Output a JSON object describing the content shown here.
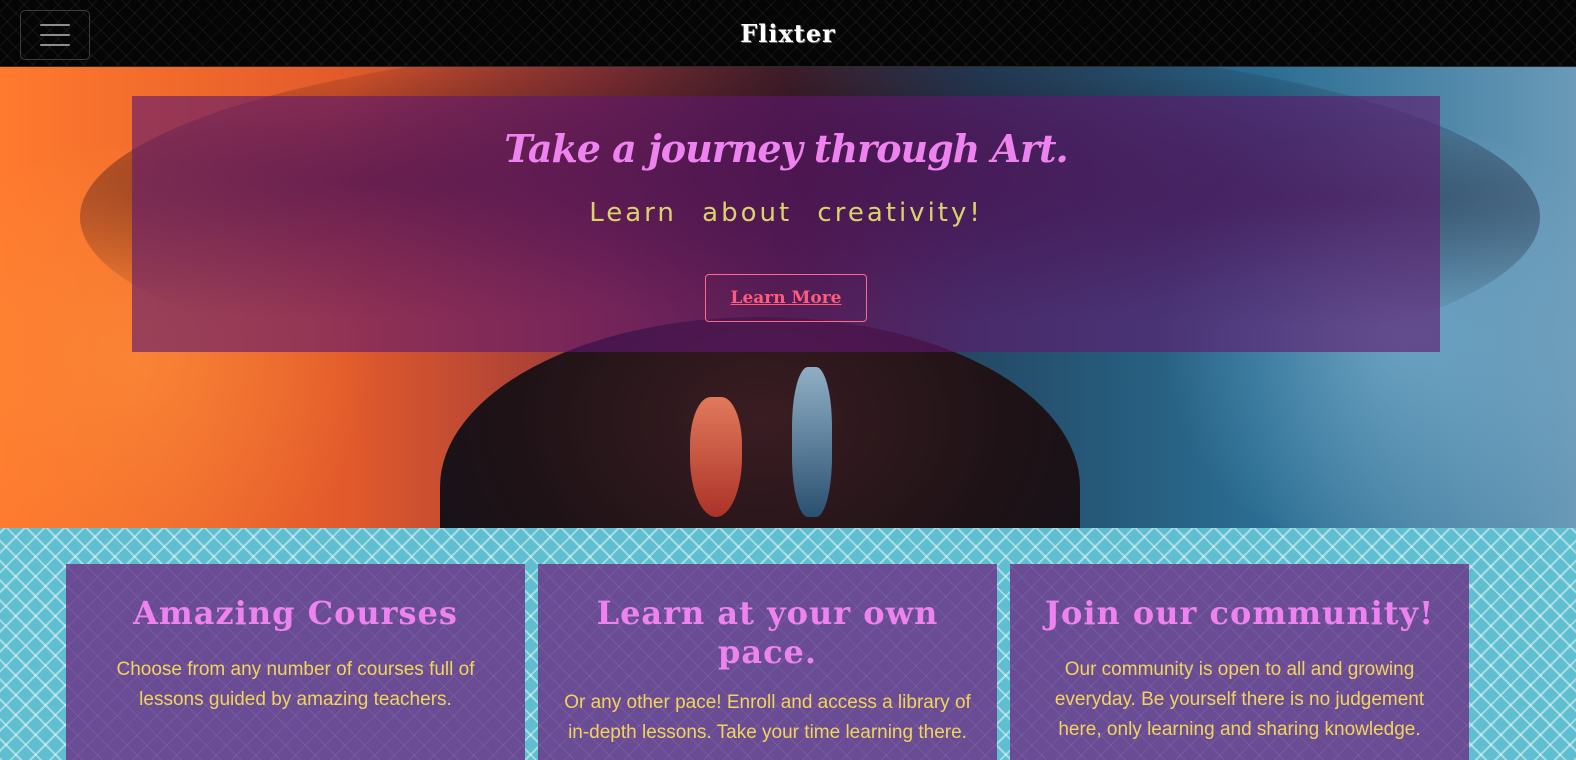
{
  "navbar": {
    "toggler_icon": "menu-icon",
    "brand": "Flixter"
  },
  "hero": {
    "title": "Take a journey through Art.",
    "subtitle": "Learn about creativity!",
    "button_label": "Learn More"
  },
  "features": [
    {
      "title": "Amazing Courses",
      "text": "Choose from any number of courses full of lessons guided by amazing teachers."
    },
    {
      "title": "Learn at your own pace.",
      "text": "Or any other pace! Enroll and access a library of in-depth lessons. Take your time learning there."
    },
    {
      "title": "Join our community!",
      "text": "Our community is open to all and growing everyday. Be yourself there is no judgement here, only learning and sharing knowledge."
    }
  ],
  "colors": {
    "navbar_bg": "#050505",
    "hero_card_bg": "#5f196e",
    "title_pink": "#ee82ee",
    "subtitle_yellow": "#d9d36a",
    "button_red": "#ff5c7c",
    "features_bg": "#5fbfd0",
    "feature_card_bg": "#6a4c95",
    "feature_text": "#f2d45a"
  }
}
